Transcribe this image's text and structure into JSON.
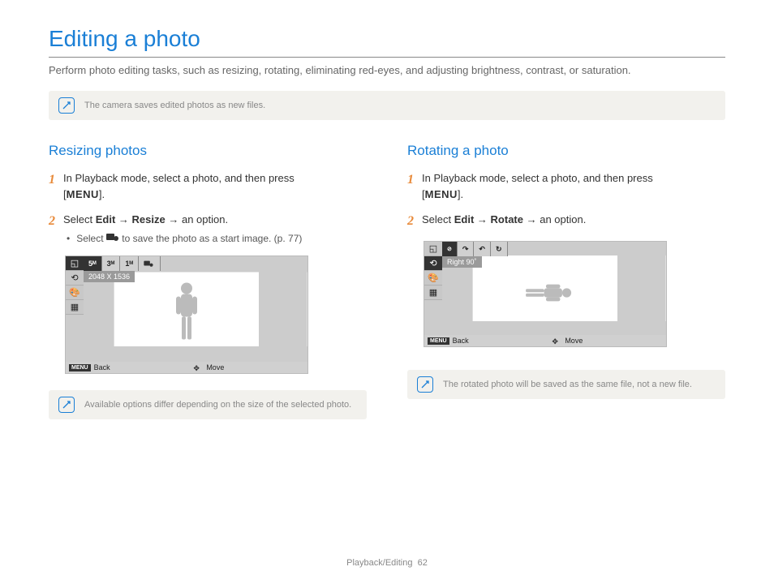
{
  "title": "Editing a photo",
  "intro": "Perform photo editing tasks, such as resizing, rotating, eliminating red-eyes, and adjusting brightness, contrast, or saturation.",
  "top_note": "The camera saves edited photos as new files.",
  "left": {
    "heading": "Resizing photos",
    "step1_a": "In Playback mode, select a photo, and then press ",
    "step1_b": "[",
    "menu": "MENU",
    "step1_c": "].",
    "step2_a": "Select ",
    "edit": "Edit",
    "arrow": " → ",
    "resize": "Resize",
    "step2_b": " → an option.",
    "bullet": "Select       to save the photo as a start image. (p. 77)",
    "bullet_pre": "Select ",
    "bullet_post": " to save the photo as a start image. (p. 77)",
    "screen": {
      "opts": [
        "5ᴹ",
        "3ᴹ",
        "1ᴹ"
      ],
      "label": "2048 X 1536",
      "back": "Back",
      "move": "Move",
      "menu_tag": "MENU"
    },
    "bottom_note": "Available options differ depending on the size of the selected photo."
  },
  "right": {
    "heading": "Rotating a photo",
    "step1_a": "In Playback mode, select a photo, and then press ",
    "step1_b": "[",
    "menu": "MENU",
    "step1_c": "].",
    "step2_a": "Select ",
    "edit": "Edit",
    "arrow": " → ",
    "rotate": "Rotate",
    "step2_b": " → an option.",
    "screen": {
      "label": "Right 90˚",
      "back": "Back",
      "move": "Move",
      "menu_tag": "MENU"
    },
    "bottom_note": "The rotated photo will be saved as the same file, not a new file."
  },
  "footer_section": "Playback/Editing",
  "footer_page": "62"
}
